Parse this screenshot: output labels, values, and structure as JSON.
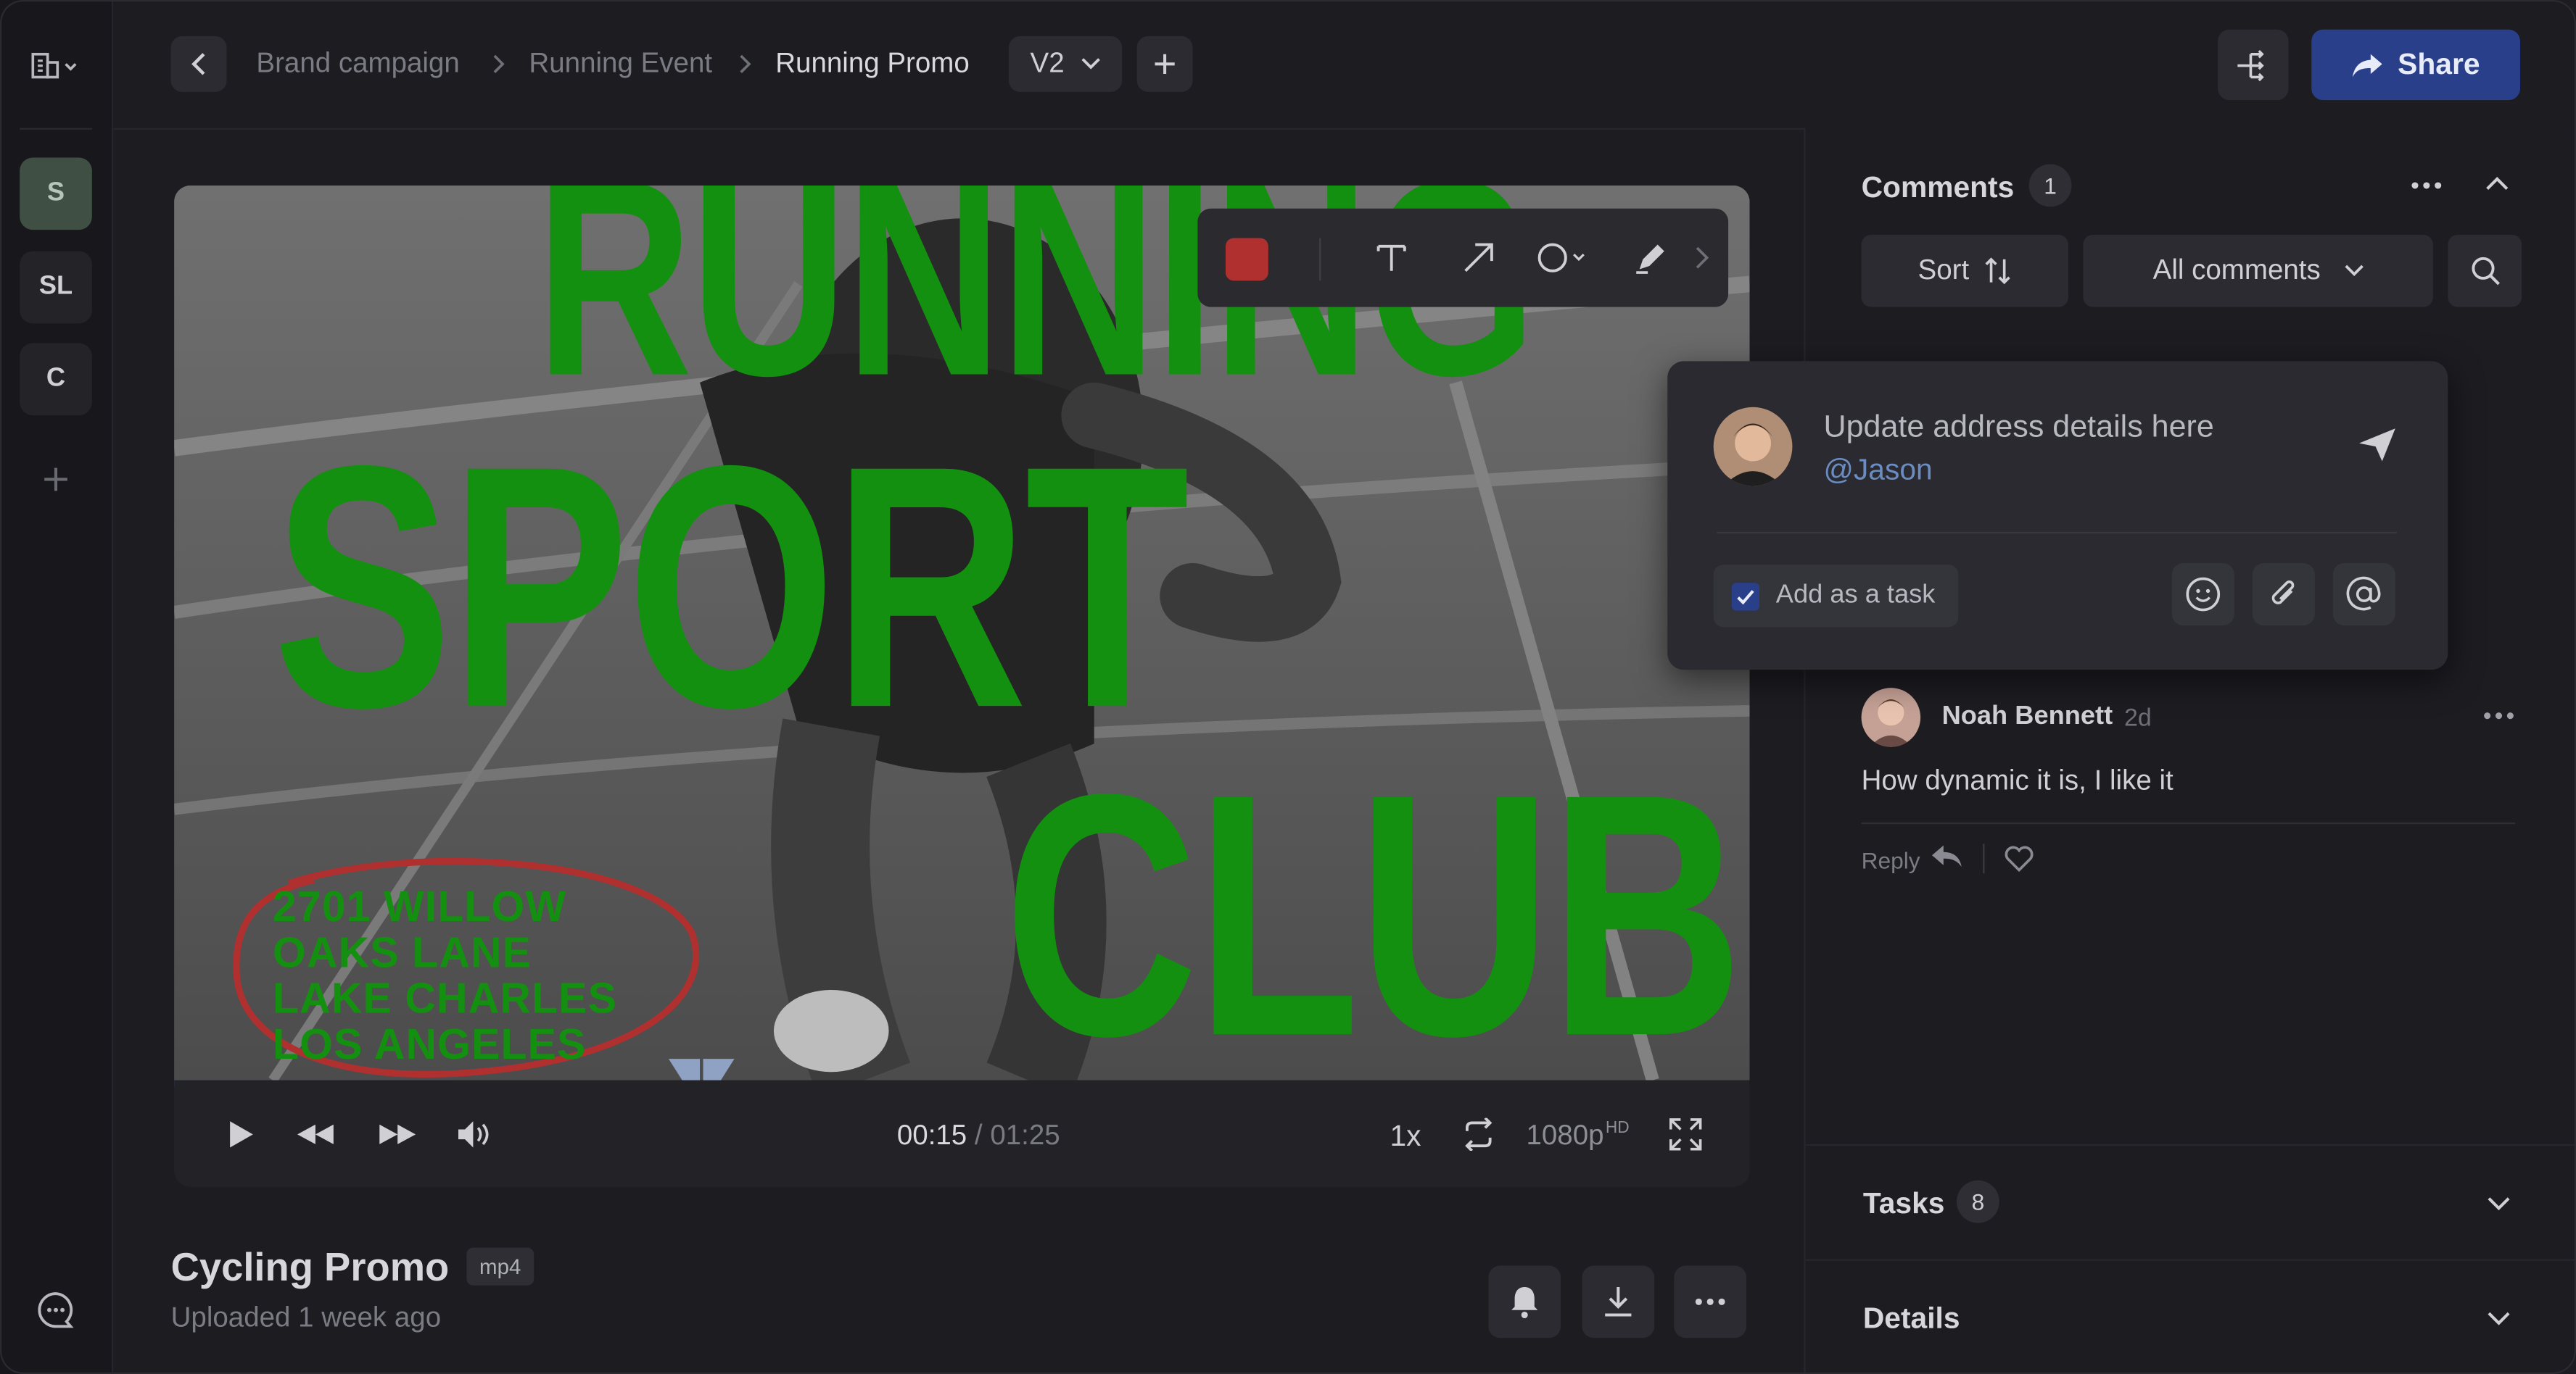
{
  "colors": {
    "accent": "#2a3f8a",
    "overlay_green": "#13900f",
    "annotation_red": "#b03030"
  },
  "rail": {
    "workspaces": [
      {
        "label": "S"
      },
      {
        "label": "SL"
      },
      {
        "label": "C"
      }
    ]
  },
  "breadcrumb": {
    "items": [
      "Brand campaign",
      "Running Event",
      "Running Promo"
    ],
    "version": "V2"
  },
  "header": {
    "share_label": "Share"
  },
  "video": {
    "overlay_words": [
      "RUNNING",
      "SPORT",
      "CLUB"
    ],
    "address_lines": [
      "2701 WILLOW",
      "OAKS LANE",
      "LAKE CHARLES",
      "LOS ANGELES"
    ],
    "progress": 0.176,
    "time_current": "00:15",
    "time_separator": " / ",
    "time_total": "01:25",
    "speed": "1x",
    "quality": "1080p",
    "quality_badge": "HD"
  },
  "asset": {
    "title": "Cycling Promo",
    "format": "mp4",
    "uploaded": "Uploaded 1 week ago"
  },
  "comments": {
    "title": "Comments",
    "count": "1",
    "sort_label": "Sort",
    "filter_label": "All comments",
    "draft": {
      "text": "Update address details here",
      "mention": "@Jason",
      "task_label": "Add as a task",
      "task_checked": true
    },
    "list": [
      {
        "author": "Noah Bennett",
        "age": "2d",
        "body": "How dynamic it is, I like it",
        "reply_label": "Reply"
      }
    ]
  },
  "tasks": {
    "title": "Tasks",
    "count": "8"
  },
  "details": {
    "title": "Details"
  }
}
